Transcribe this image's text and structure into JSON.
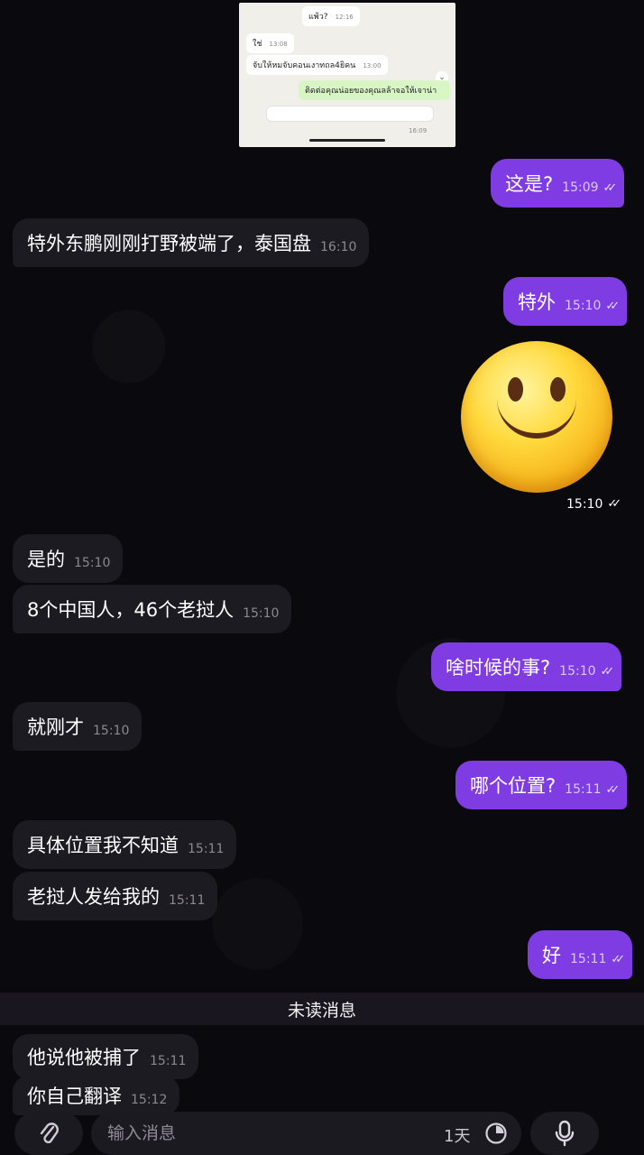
{
  "quoted_screenshot": {
    "rows": [
      {
        "side": "in",
        "text": "แพ้ว?",
        "time": "12:16"
      },
      {
        "side": "in",
        "text": "ใช่",
        "time": "13:08"
      },
      {
        "side": "in",
        "text": "จับให้หมจับคอนเงาทถล4ยิคน",
        "time": "13:00"
      },
      {
        "side": "out",
        "text": "ติดต่อคุณน่อยของคุณลล้าจอให้เจาน่า",
        "time": ""
      },
      {
        "side": "out",
        "text": "",
        "time": "16:09"
      }
    ],
    "chevron": "⌄"
  },
  "messages": [
    {
      "side": "out",
      "text": "这是?",
      "time": "15:09",
      "ticks": "✓✓"
    },
    {
      "side": "in",
      "text": "特外东鹏刚刚打野被端了，泰国盘",
      "time": "16:10"
    },
    {
      "side": "out",
      "text": "特外",
      "time": "15:10",
      "ticks": "✓✓"
    },
    {
      "side": "in",
      "text": "是的",
      "time": "15:10"
    },
    {
      "side": "in",
      "text": "8个中国人，46个老挝人",
      "time": "15:10"
    },
    {
      "side": "out",
      "text": "啥时候的事?",
      "time": "15:10",
      "ticks": "✓✓"
    },
    {
      "side": "in",
      "text": "就刚才",
      "time": "15:10"
    },
    {
      "side": "out",
      "text": "哪个位置?",
      "time": "15:11",
      "ticks": "✓✓"
    },
    {
      "side": "in",
      "text": "具体位置我不知道",
      "time": "15:11"
    },
    {
      "side": "in",
      "text": "老挝人发给我的",
      "time": "15:11"
    },
    {
      "side": "out",
      "text": "好",
      "time": "15:11",
      "ticks": "✓✓"
    },
    {
      "side": "in",
      "text": "他说他被捕了",
      "time": "15:11"
    },
    {
      "side": "in",
      "text": "你自己翻译",
      "time": "15:12"
    }
  ],
  "sticker": {
    "name": "slightly-smiling-face",
    "time": "15:10",
    "ticks": "✓✓"
  },
  "unread_divider": "未读消息",
  "composer": {
    "placeholder": "输入消息",
    "timer_label": "1天",
    "attach_icon": "paperclip-icon",
    "timer_icon": "self-destruct-timer-icon",
    "mic_icon": "microphone-icon"
  },
  "colors": {
    "background": "#0a090d",
    "incoming_bubble": "#1d1b22",
    "outgoing_bubble": "#7f3ce3",
    "divider": "#1a1620"
  }
}
